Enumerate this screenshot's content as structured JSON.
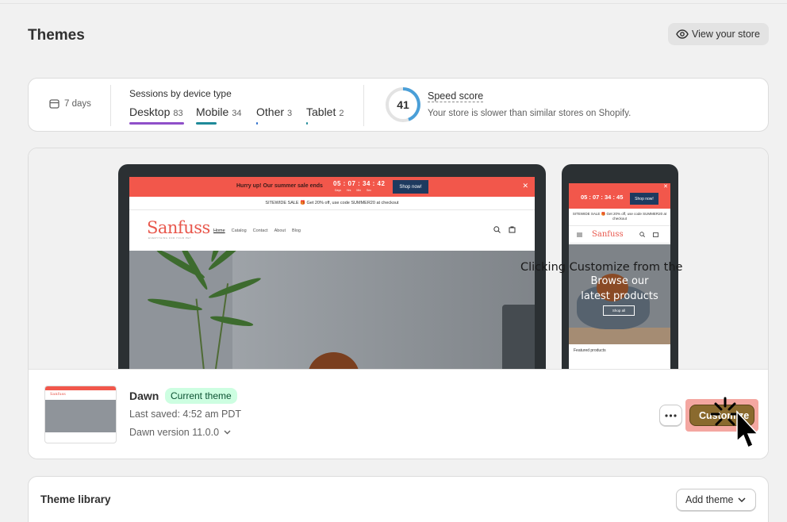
{
  "page": {
    "title": "Themes",
    "view_store_label": "View your store"
  },
  "stats": {
    "date_range": "7 days",
    "sessions_title": "Sessions by device type",
    "devices": [
      {
        "label": "Desktop",
        "count": "83",
        "color": "#8f4fc9"
      },
      {
        "label": "Mobile",
        "count": "34",
        "color": "#1f8a99"
      },
      {
        "label": "Other",
        "count": "3",
        "color": "#2c6ecb"
      },
      {
        "label": "Tablet",
        "count": "2",
        "color": "#1f8a99"
      }
    ],
    "speed_score": "41",
    "speed_label": "Speed score",
    "speed_desc": "Your store is slower than similar stores on Shopify."
  },
  "preview": {
    "promo_text": "Hurry up! Our summer sale ends",
    "timer": "05 : 07 : 34 : 42",
    "timer_labels": "Days Hrs Min Sec",
    "shop_now": "Shop now!",
    "sitewide": "SITEWIDE SALE 🎁 Get 20% off, use code SUMMER20 at checkout",
    "logo": "Sanfuss",
    "logo_sub": "EVERYTHING FOR YOUR PET",
    "nav_links": [
      "Home",
      "Catalog",
      "Contact",
      "About",
      "Blog"
    ],
    "mobile_timer": "05 : 07 : 34 : 45",
    "mobile_sitewide": "SITEWIDE SALE 🎁 Get 20% off, use code SUMMER20 at checkout",
    "hero_caption": "Browse our latest products",
    "shop_all": "Shop all",
    "featured": "Featured products",
    "tooltip": "Clicking Customize from the"
  },
  "current_theme": {
    "name": "Dawn",
    "badge": "Current theme",
    "last_saved": "Last saved: 4:52 am PDT",
    "version": "Dawn version 11.0.0",
    "customize_label": "Customize"
  },
  "library": {
    "title": "Theme library",
    "add_theme_label": "Add theme"
  }
}
